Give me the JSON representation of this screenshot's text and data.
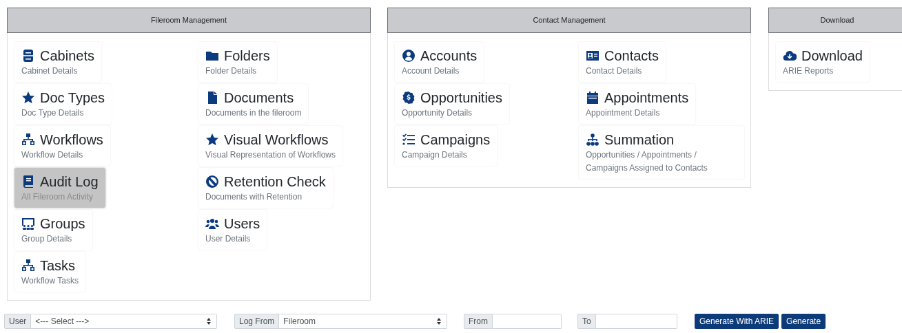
{
  "sections": [
    {
      "title": "Fileroom Management",
      "items": [
        {
          "title": "Cabinets",
          "subtitle": "Cabinet Details",
          "selected": false
        },
        {
          "title": "Folders",
          "subtitle": "Folder Details",
          "selected": false
        },
        {
          "title": "Doc Types",
          "subtitle": "Doc Type Details",
          "selected": false
        },
        {
          "title": "Documents",
          "subtitle": "Documents in the fileroom",
          "selected": false
        },
        {
          "title": "Workflows",
          "subtitle": "Workflow Details",
          "selected": false
        },
        {
          "title": "Visual Workflows",
          "subtitle": "Visual Representation of Workflows",
          "selected": false
        },
        {
          "title": "Audit Log",
          "subtitle": "All Fileroom Activity",
          "selected": true
        },
        {
          "title": "Retention Check",
          "subtitle": "Documents with Retention",
          "selected": false
        },
        {
          "title": "Groups",
          "subtitle": "Group Details",
          "selected": false
        },
        {
          "title": "Users",
          "subtitle": "User Details",
          "selected": false
        },
        {
          "title": "Tasks",
          "subtitle": "Workflow Tasks",
          "selected": false
        }
      ]
    },
    {
      "title": "Contact Management",
      "items": [
        {
          "title": "Accounts",
          "subtitle": "Account Details",
          "selected": false
        },
        {
          "title": "Contacts",
          "subtitle": "Contact Details",
          "selected": false
        },
        {
          "title": "Opportunities",
          "subtitle": "Opportunity Details",
          "selected": false
        },
        {
          "title": "Appointments",
          "subtitle": "Appointment Details",
          "selected": false
        },
        {
          "title": "Campaigns",
          "subtitle": "Campaign Details",
          "selected": false
        },
        {
          "title": "Summation",
          "subtitle": "Opportunities / Appointments / Campaigns Assigned to Contacts",
          "selected": false
        }
      ]
    },
    {
      "title": "Download",
      "items": [
        {
          "title": "Download",
          "subtitle": "ARIE Reports",
          "selected": false
        }
      ]
    }
  ],
  "filters": [
    {
      "kind": "select",
      "label": "User",
      "value": "<--- Select --->"
    },
    {
      "kind": "select",
      "label": "Log From",
      "value": "Fileroom"
    },
    {
      "kind": "input",
      "label": "From"
    },
    {
      "kind": "input",
      "label": "To"
    }
  ],
  "buttons": [
    "Generate With ARIE",
    "Generate"
  ]
}
